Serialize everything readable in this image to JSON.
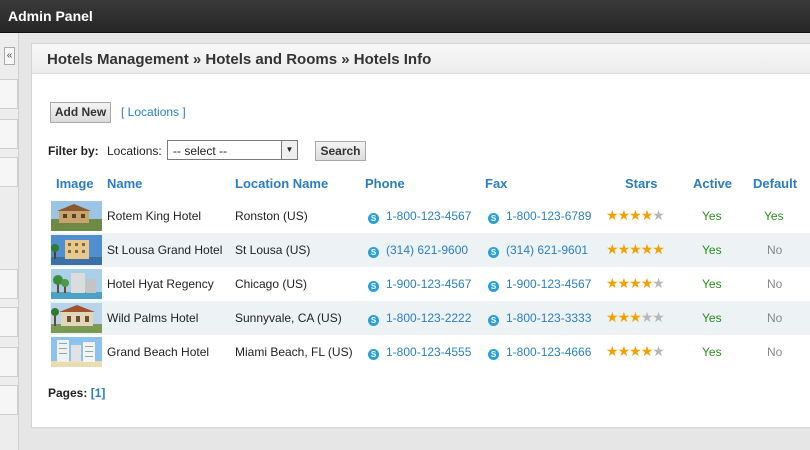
{
  "app": {
    "title": "Admin Panel"
  },
  "sidebar": {
    "collapse_label": "«"
  },
  "breadcrumb": "Hotels Management » Hotels and Rooms » Hotels Info",
  "toolbar": {
    "add_new_label": "Add New",
    "locations_link": "[ Locations ]"
  },
  "filter": {
    "label": "Filter by:",
    "locations_label": "Locations:",
    "select_value": "-- select --",
    "search_label": "Search"
  },
  "table": {
    "headers": {
      "image": "Image",
      "name": "Name",
      "location": "Location Name",
      "phone": "Phone",
      "fax": "Fax",
      "stars": "Stars",
      "active": "Active",
      "default": "Default"
    },
    "rows": [
      {
        "name": "Rotem King Hotel",
        "location": "Ronston (US)",
        "phone": "1-800-123-4567",
        "fax": "1-800-123-6789",
        "stars": 4,
        "active": "Yes",
        "default": "Yes"
      },
      {
        "name": "St Lousa Grand Hotel",
        "location": "St Lousa (US)",
        "phone": "(314) 621-9600",
        "fax": "(314) 621-9601",
        "stars": 5,
        "active": "Yes",
        "default": "No"
      },
      {
        "name": "Hotel Hyat Regency",
        "location": "Chicago (US)",
        "phone": "1-900-123-4567",
        "fax": "1-900-123-4567",
        "stars": 4,
        "active": "Yes",
        "default": "No"
      },
      {
        "name": "Wild Palms Hotel",
        "location": "Sunnyvale, CA (US)",
        "phone": "1-800-123-2222",
        "fax": "1-800-123-3333",
        "stars": 3,
        "active": "Yes",
        "default": "No"
      },
      {
        "name": "Grand Beach Hotel",
        "location": "Miami Beach, FL (US)",
        "phone": "1-800-123-4555",
        "fax": "1-800-123-4666",
        "stars": 4,
        "active": "Yes",
        "default": "No"
      }
    ]
  },
  "pagination": {
    "label": "Pages:",
    "current": "[1]"
  },
  "colors": {
    "accent": "#2b7cc1",
    "star": "#f2a100",
    "active_yes": "#2a8a1e",
    "topbar": "#2c2c2c"
  }
}
